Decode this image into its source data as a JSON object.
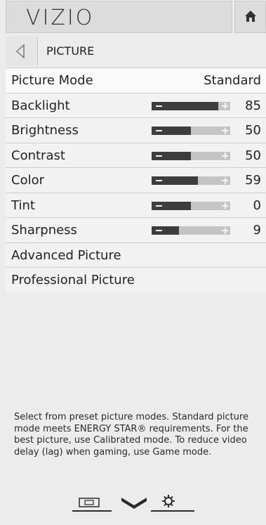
{
  "header": {
    "logo": "VIZIO",
    "home_icon": "home-icon"
  },
  "breadcrumb": {
    "back_icon": "triangle-left-icon",
    "label": "PICTURE"
  },
  "rows": [
    {
      "label": "Picture Mode",
      "value": "Standard"
    },
    {
      "label": "Backlight",
      "value": "85",
      "level": 0.85
    },
    {
      "label": "Brightness",
      "value": "50",
      "level": 0.5
    },
    {
      "label": "Contrast",
      "value": "50",
      "level": 0.5
    },
    {
      "label": "Color",
      "value": "59",
      "level": 0.59
    },
    {
      "label": "Tint",
      "value": "0",
      "level": 0.5
    },
    {
      "label": "Sharpness",
      "value": "9",
      "level": 0.35
    },
    {
      "label": "Advanced Picture"
    },
    {
      "label": "Professional Picture"
    }
  ],
  "help_text": "Select from preset picture modes. Standard picture mode meets ENERGY STAR® requirements. For the best picture, use Calibrated mode. To reduce video delay (lag) when gaming, use Game mode.",
  "nav": {
    "icons": [
      "screen-icon",
      "vizio-v-icon",
      "gear-icon"
    ]
  }
}
